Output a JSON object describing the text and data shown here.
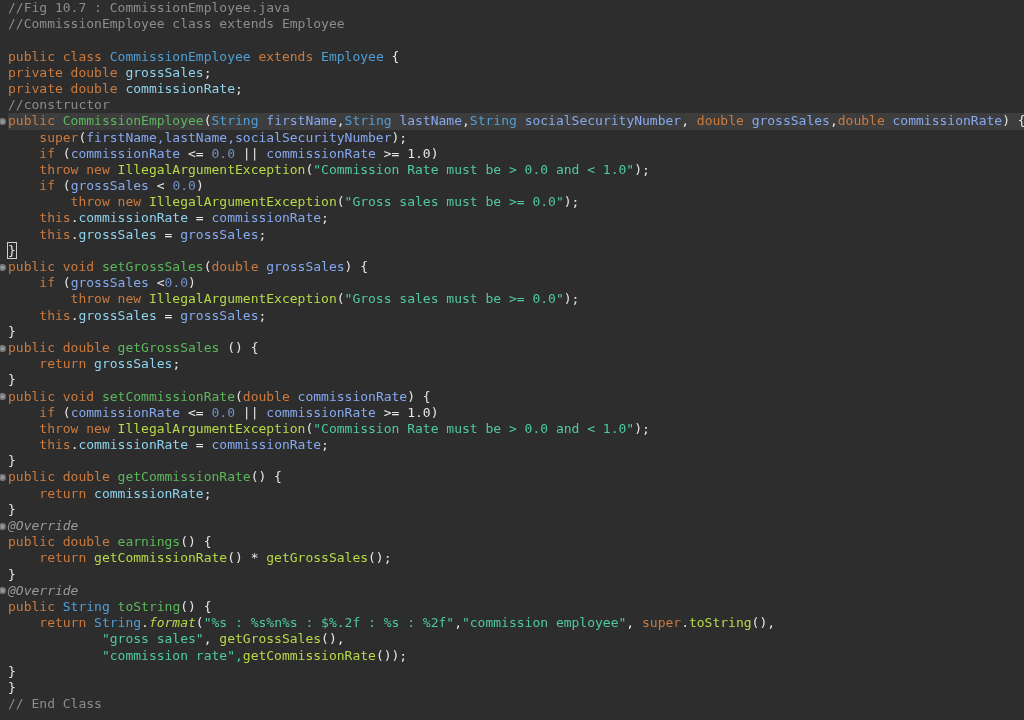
{
  "editor": {
    "lines": [
      {
        "fold": false,
        "current": false,
        "tokens": [
          {
            "kind": "c",
            "text": "//Fig 10.7 : CommissionEmployee.java"
          }
        ]
      },
      {
        "fold": false,
        "current": false,
        "tokens": [
          {
            "kind": "c",
            "text": "//CommissionEmployee class extends Employee"
          }
        ]
      },
      {
        "fold": false,
        "current": false
      },
      {
        "fold": false,
        "current": false,
        "tokens": [
          {
            "kind": "k",
            "text": "public class "
          },
          {
            "kind": "t",
            "text": "CommissionEmployee"
          },
          {
            "kind": "k",
            "text": " extends "
          },
          {
            "kind": "t",
            "text": "Employee"
          },
          {
            "kind": "x",
            "text": " {"
          }
        ]
      },
      {
        "fold": false,
        "current": false,
        "tokens": [
          {
            "kind": "k",
            "text": "private double "
          },
          {
            "kind": "f",
            "text": "grossSales"
          },
          {
            "kind": "x",
            "text": ";"
          }
        ]
      },
      {
        "fold": false,
        "current": false,
        "tokens": [
          {
            "kind": "k",
            "text": "private double "
          },
          {
            "kind": "f",
            "text": "commissionRate"
          },
          {
            "kind": "x",
            "text": ";"
          }
        ]
      },
      {
        "fold": false,
        "current": false,
        "tokens": [
          {
            "kind": "c",
            "text": "//constructor"
          }
        ]
      },
      {
        "fold": true,
        "current": true,
        "tokens": [
          {
            "kind": "k",
            "text": "public "
          },
          {
            "kind": "d",
            "text": "CommissionEmployee"
          },
          {
            "kind": "x",
            "text": "("
          },
          {
            "kind": "t",
            "text": "String "
          },
          {
            "kind": "p",
            "text": "firstName"
          },
          {
            "kind": "x",
            "text": ","
          },
          {
            "kind": "t",
            "text": "String "
          },
          {
            "kind": "p",
            "text": "lastName"
          },
          {
            "kind": "x",
            "text": ","
          },
          {
            "kind": "t",
            "text": "String "
          },
          {
            "kind": "p",
            "text": "socialSecurityNumber"
          },
          {
            "kind": "x",
            "text": ", "
          },
          {
            "kind": "k",
            "text": "double "
          },
          {
            "kind": "p",
            "text": "grossSales"
          },
          {
            "kind": "x",
            "text": ","
          },
          {
            "kind": "k",
            "text": "double "
          },
          {
            "kind": "p",
            "text": "commissionRate"
          },
          {
            "kind": "x",
            "text": ") {"
          }
        ]
      },
      {
        "fold": false,
        "current": false,
        "tokens": [
          {
            "kind": "k",
            "text": "    super"
          },
          {
            "kind": "x",
            "text": "("
          },
          {
            "kind": "p",
            "text": "firstName,lastName,socialSecurityNumber"
          },
          {
            "kind": "x",
            "text": ");"
          }
        ]
      },
      {
        "fold": false,
        "current": false,
        "tokens": [
          {
            "kind": "k",
            "text": "    if "
          },
          {
            "kind": "x",
            "text": "("
          },
          {
            "kind": "p",
            "text": "commissionRate"
          },
          {
            "kind": "x",
            "text": " <= "
          },
          {
            "kind": "n",
            "text": "0.0"
          },
          {
            "kind": "x",
            "text": " || "
          },
          {
            "kind": "p",
            "text": "commissionRate"
          },
          {
            "kind": "x",
            "text": " >= "
          },
          {
            "kind": "x",
            "text": "1.0)"
          }
        ]
      },
      {
        "fold": false,
        "current": false,
        "tokens": [
          {
            "kind": "k",
            "text": "    throw new "
          },
          {
            "kind": "m",
            "text": "IllegalArgumentException"
          },
          {
            "kind": "x",
            "text": "("
          },
          {
            "kind": "s",
            "text": "\"Commission Rate must be > 0.0 and < 1.0\""
          },
          {
            "kind": "x",
            "text": ");"
          }
        ]
      },
      {
        "fold": false,
        "current": false,
        "tokens": [
          {
            "kind": "k",
            "text": "    if "
          },
          {
            "kind": "x",
            "text": "("
          },
          {
            "kind": "p",
            "text": "grossSales"
          },
          {
            "kind": "x",
            "text": " < "
          },
          {
            "kind": "n",
            "text": "0.0"
          },
          {
            "kind": "x",
            "text": ")"
          }
        ]
      },
      {
        "fold": false,
        "current": false,
        "tokens": [
          {
            "kind": "k",
            "text": "        throw new "
          },
          {
            "kind": "m",
            "text": "IllegalArgumentException"
          },
          {
            "kind": "x",
            "text": "("
          },
          {
            "kind": "s",
            "text": "\"Gross sales must be >= 0.0\""
          },
          {
            "kind": "x",
            "text": ");"
          }
        ]
      },
      {
        "fold": false,
        "current": false,
        "tokens": [
          {
            "kind": "k",
            "text": "    this"
          },
          {
            "kind": "x",
            "text": "."
          },
          {
            "kind": "f",
            "text": "commissionRate"
          },
          {
            "kind": "x",
            "text": " = "
          },
          {
            "kind": "p",
            "text": "commissionRate"
          },
          {
            "kind": "x",
            "text": ";"
          }
        ]
      },
      {
        "fold": false,
        "current": false,
        "tokens": [
          {
            "kind": "k",
            "text": "    this"
          },
          {
            "kind": "x",
            "text": "."
          },
          {
            "kind": "f",
            "text": "grossSales"
          },
          {
            "kind": "x",
            "text": " = "
          },
          {
            "kind": "p",
            "text": "grossSales"
          },
          {
            "kind": "x",
            "text": ";"
          }
        ]
      },
      {
        "fold": false,
        "current": false,
        "tokens": [
          {
            "kind": "b",
            "text": "}"
          }
        ]
      },
      {
        "fold": true,
        "current": false,
        "tokens": [
          {
            "kind": "k",
            "text": "public void "
          },
          {
            "kind": "d",
            "text": "setGrossSales"
          },
          {
            "kind": "x",
            "text": "("
          },
          {
            "kind": "k",
            "text": "double "
          },
          {
            "kind": "p",
            "text": "grossSales"
          },
          {
            "kind": "x",
            "text": ") {"
          }
        ]
      },
      {
        "fold": false,
        "current": false,
        "tokens": [
          {
            "kind": "k",
            "text": "    if "
          },
          {
            "kind": "x",
            "text": "("
          },
          {
            "kind": "p",
            "text": "grossSales"
          },
          {
            "kind": "x",
            "text": " <"
          },
          {
            "kind": "n",
            "text": "0.0"
          },
          {
            "kind": "x",
            "text": ")"
          }
        ]
      },
      {
        "fold": false,
        "current": false,
        "tokens": [
          {
            "kind": "k",
            "text": "        throw new "
          },
          {
            "kind": "m",
            "text": "IllegalArgumentException"
          },
          {
            "kind": "x",
            "text": "("
          },
          {
            "kind": "s",
            "text": "\"Gross sales must be >= 0.0\""
          },
          {
            "kind": "x",
            "text": ");"
          }
        ]
      },
      {
        "fold": false,
        "current": false,
        "tokens": [
          {
            "kind": "k",
            "text": "    this"
          },
          {
            "kind": "x",
            "text": "."
          },
          {
            "kind": "f",
            "text": "grossSales"
          },
          {
            "kind": "x",
            "text": " = "
          },
          {
            "kind": "p",
            "text": "grossSales"
          },
          {
            "kind": "x",
            "text": ";"
          }
        ]
      },
      {
        "fold": false,
        "current": false,
        "tokens": [
          {
            "kind": "x",
            "text": "}"
          }
        ]
      },
      {
        "fold": true,
        "current": false,
        "tokens": [
          {
            "kind": "k",
            "text": "public double "
          },
          {
            "kind": "d",
            "text": "getGrossSales"
          },
          {
            "kind": "x",
            "text": " () {"
          }
        ]
      },
      {
        "fold": false,
        "current": false,
        "tokens": [
          {
            "kind": "k",
            "text": "    return "
          },
          {
            "kind": "f",
            "text": "grossSales"
          },
          {
            "kind": "x",
            "text": ";"
          }
        ]
      },
      {
        "fold": false,
        "current": false,
        "tokens": [
          {
            "kind": "x",
            "text": "}"
          }
        ]
      },
      {
        "fold": true,
        "current": false,
        "tokens": [
          {
            "kind": "k",
            "text": "public void "
          },
          {
            "kind": "d",
            "text": "setCommissionRate"
          },
          {
            "kind": "x",
            "text": "("
          },
          {
            "kind": "k",
            "text": "double "
          },
          {
            "kind": "p",
            "text": "commissionRate"
          },
          {
            "kind": "x",
            "text": ") {"
          }
        ]
      },
      {
        "fold": false,
        "current": false,
        "tokens": [
          {
            "kind": "k",
            "text": "    if "
          },
          {
            "kind": "x",
            "text": "("
          },
          {
            "kind": "p",
            "text": "commissionRate"
          },
          {
            "kind": "x",
            "text": " <= "
          },
          {
            "kind": "n",
            "text": "0.0"
          },
          {
            "kind": "x",
            "text": " || "
          },
          {
            "kind": "p",
            "text": "commissionRate"
          },
          {
            "kind": "x",
            "text": " >= "
          },
          {
            "kind": "x",
            "text": "1.0)"
          }
        ]
      },
      {
        "fold": false,
        "current": false,
        "tokens": [
          {
            "kind": "k",
            "text": "    throw new "
          },
          {
            "kind": "m",
            "text": "IllegalArgumentException"
          },
          {
            "kind": "x",
            "text": "("
          },
          {
            "kind": "s",
            "text": "\"Commission Rate must be > 0.0 and < 1.0\""
          },
          {
            "kind": "x",
            "text": ");"
          }
        ]
      },
      {
        "fold": false,
        "current": false,
        "tokens": [
          {
            "kind": "k",
            "text": "    this"
          },
          {
            "kind": "x",
            "text": "."
          },
          {
            "kind": "f",
            "text": "commissionRate"
          },
          {
            "kind": "x",
            "text": " = "
          },
          {
            "kind": "p",
            "text": "commissionRate"
          },
          {
            "kind": "x",
            "text": ";"
          }
        ]
      },
      {
        "fold": false,
        "current": false,
        "tokens": [
          {
            "kind": "x",
            "text": "}"
          }
        ]
      },
      {
        "fold": true,
        "current": false,
        "tokens": [
          {
            "kind": "k",
            "text": "public double "
          },
          {
            "kind": "d",
            "text": "getCommissionRate"
          },
          {
            "kind": "x",
            "text": "() {"
          }
        ]
      },
      {
        "fold": false,
        "current": false,
        "tokens": [
          {
            "kind": "k",
            "text": "    return "
          },
          {
            "kind": "f",
            "text": "commissionRate"
          },
          {
            "kind": "x",
            "text": ";"
          }
        ]
      },
      {
        "fold": false,
        "current": false,
        "tokens": [
          {
            "kind": "x",
            "text": "}"
          }
        ]
      },
      {
        "fold": true,
        "current": false,
        "tokens": [
          {
            "kind": "a",
            "text": "@Override"
          }
        ]
      },
      {
        "fold": false,
        "current": false,
        "tokens": [
          {
            "kind": "k",
            "text": "public double "
          },
          {
            "kind": "d",
            "text": "earnings"
          },
          {
            "kind": "x",
            "text": "() {"
          }
        ]
      },
      {
        "fold": false,
        "current": false,
        "tokens": [
          {
            "kind": "k",
            "text": "    return "
          },
          {
            "kind": "m",
            "text": "getCommissionRate"
          },
          {
            "kind": "x",
            "text": "() * "
          },
          {
            "kind": "m",
            "text": "getGrossSales"
          },
          {
            "kind": "x",
            "text": "();"
          }
        ]
      },
      {
        "fold": false,
        "current": false,
        "tokens": [
          {
            "kind": "x",
            "text": "}"
          }
        ]
      },
      {
        "fold": true,
        "current": false,
        "tokens": [
          {
            "kind": "a",
            "text": "@Override"
          }
        ]
      },
      {
        "fold": false,
        "current": false,
        "tokens": [
          {
            "kind": "k",
            "text": "public "
          },
          {
            "kind": "t",
            "text": "String "
          },
          {
            "kind": "d",
            "text": "toString"
          },
          {
            "kind": "x",
            "text": "() {"
          }
        ]
      },
      {
        "fold": false,
        "current": false,
        "tokens": [
          {
            "kind": "k",
            "text": "    return "
          },
          {
            "kind": "t",
            "text": "String"
          },
          {
            "kind": "x",
            "text": "."
          },
          {
            "kind": "i",
            "text": "format"
          },
          {
            "kind": "x",
            "text": "("
          },
          {
            "kind": "s",
            "text": "\"%s : %s%n%s : $%.2f : %s : %2f\""
          },
          {
            "kind": "x",
            "text": ","
          },
          {
            "kind": "s",
            "text": "\"commission employee\""
          },
          {
            "kind": "x",
            "text": ", "
          },
          {
            "kind": "k",
            "text": "super"
          },
          {
            "kind": "x",
            "text": "."
          },
          {
            "kind": "m",
            "text": "toString"
          },
          {
            "kind": "x",
            "text": "(),"
          }
        ]
      },
      {
        "fold": false,
        "current": false,
        "tokens": [
          {
            "kind": "s",
            "text": "            \"gross sales\""
          },
          {
            "kind": "x",
            "text": ", "
          },
          {
            "kind": "m",
            "text": "getGrossSales"
          },
          {
            "kind": "x",
            "text": "(),"
          }
        ]
      },
      {
        "fold": false,
        "current": false,
        "tokens": [
          {
            "kind": "s",
            "text": "            \"commission rate\","
          },
          {
            "kind": "m",
            "text": "getCommissionRate"
          },
          {
            "kind": "x",
            "text": "());"
          }
        ]
      },
      {
        "fold": false,
        "current": false,
        "tokens": [
          {
            "kind": "x",
            "text": "}"
          }
        ]
      },
      {
        "fold": false,
        "current": false,
        "tokens": [
          {
            "kind": "x",
            "text": "}"
          }
        ]
      },
      {
        "fold": false,
        "current": false,
        "tokens": [
          {
            "kind": "c",
            "text": "// End Class"
          }
        ]
      }
    ]
  }
}
